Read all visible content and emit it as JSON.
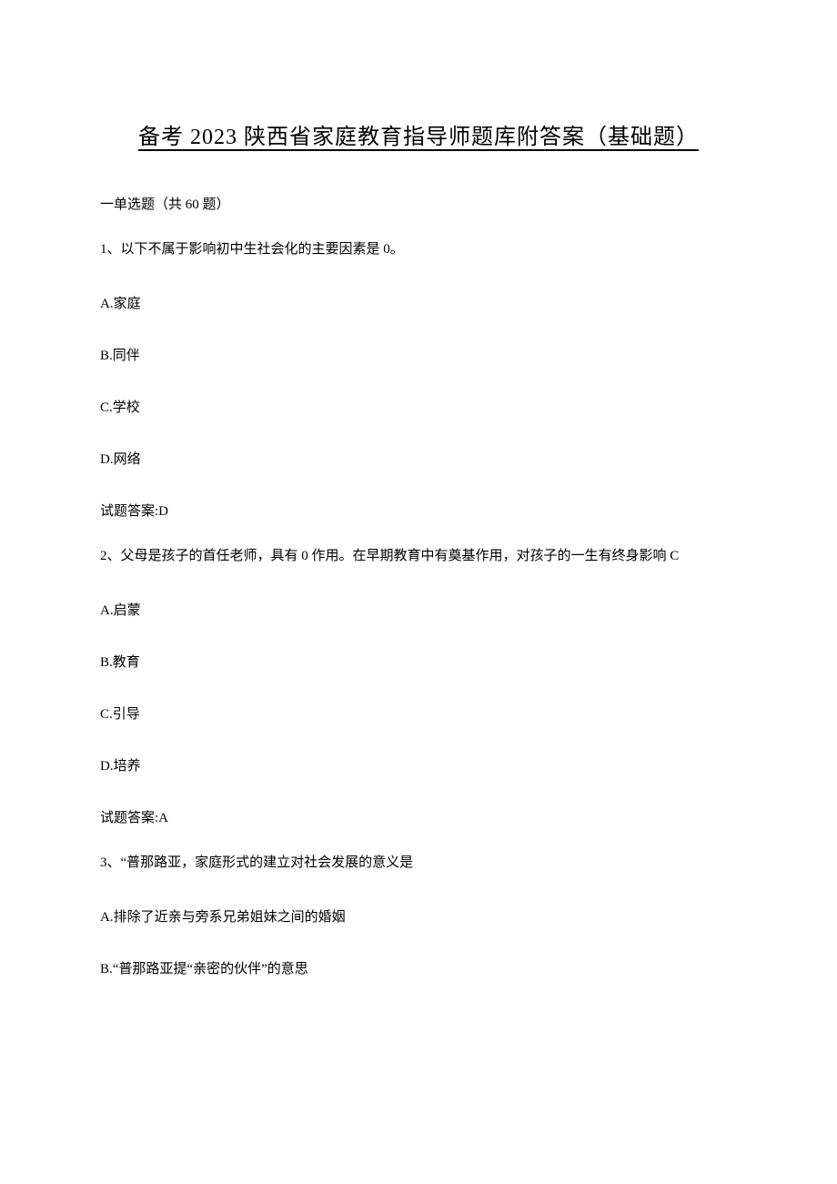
{
  "title": "备考 2023 陕西省家庭教育指导师题库附答案（基础题）",
  "section_header": "一单选题（共 60 题）",
  "q1": {
    "text": "1、以下不属于影响初中生社会化的主要因素是 0。",
    "optA": "A.家庭",
    "optB": "B.同伴",
    "optC": "C.学校",
    "optD": "D.网络",
    "answer": "试题答案:D"
  },
  "q2": {
    "text": "2、父母是孩子的首任老师，具有 0 作用。在早期教育中有奠基作用，对孩子的一生有终身影响 C",
    "optA": "A.启蒙",
    "optB": "B.教育",
    "optC": "C.引导",
    "optD": "D.培养",
    "answer": "试题答案:A"
  },
  "q3": {
    "text": "3、“普那路亚，家庭形式的建立对社会发展的意义是",
    "optA": "A.排除了近亲与旁系兄弟姐妹之间的婚姻",
    "optB": "B.“普那路亚提“亲密的伙伴”的意思"
  }
}
